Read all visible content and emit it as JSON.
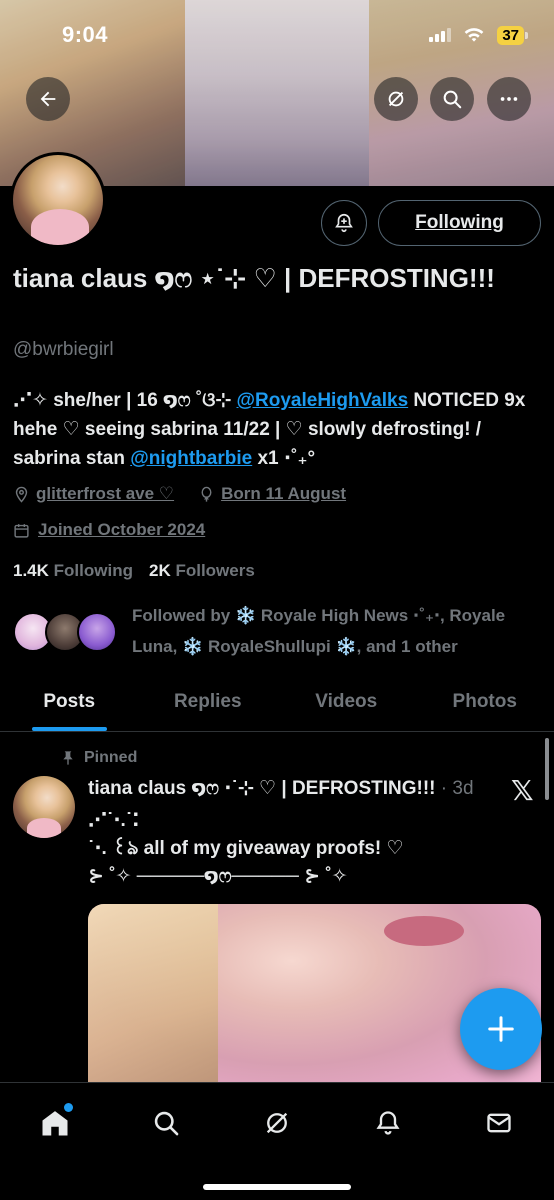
{
  "status_bar": {
    "time": "9:04",
    "battery": "37"
  },
  "profile": {
    "display_name": "tiana claus ໑ෆ ⋆˙⊹ ♡ | DEFROSTING!!!",
    "handle": "@bwrbiegirl",
    "bio_parts": {
      "p1": "⋰✧ she/her | 16 ໑ෆ ˚ଓ⊹ ",
      "link1": "@RoyaleHighValks",
      "p2": " NOTICED 9x hehe ♡ seeing sabrina 11/22 | ♡ slowly defrosting! / sabrina stan ",
      "link2": "@nightbarbie",
      "p3": " x1 ⋅˚₊°"
    },
    "location": "glitterfrost ave ♡",
    "birthday": "Born 11 August",
    "joined": "Joined October 2024",
    "following_count": "1.4K",
    "following_label": "Following",
    "followers_count": "2K",
    "followers_label": "Followers",
    "followed_by": "Followed by ❄️ Royale High News ⋅˚₊‧, Royale Luna, ❄️ RoyaleShullupi ❄️, and 1 other"
  },
  "buttons": {
    "following": "Following"
  },
  "tabs": [
    "Posts",
    "Replies",
    "Videos",
    "Photos"
  ],
  "pinned_post": {
    "pinned_label": "Pinned",
    "author": "tiana claus ໑ෆ ⋅˙⊹ ♡ | DEFROSTING!!!",
    "time": "· 3d",
    "text": "⋰˙⋅.˙⁚\n˙⋅. ꒰ঌ all of my giveaway proofs! ♡\n⊱ ˚✧ ─────໑ෆ───── ⊱ ˚✧"
  },
  "icons": {
    "back": "arrow-left-icon",
    "grok": "grok-icon",
    "search": "search-icon",
    "more": "more-icon",
    "bell": "bell-plus-icon",
    "location": "location-pin-icon",
    "birthday": "balloon-icon",
    "calendar": "calendar-icon",
    "pin": "pin-icon",
    "x_logo": "x-logo-icon",
    "compose": "plus-icon"
  },
  "colors": {
    "accent": "#1d9bf0",
    "muted": "#71767b",
    "text": "#e7e9ea",
    "background": "#000000"
  }
}
